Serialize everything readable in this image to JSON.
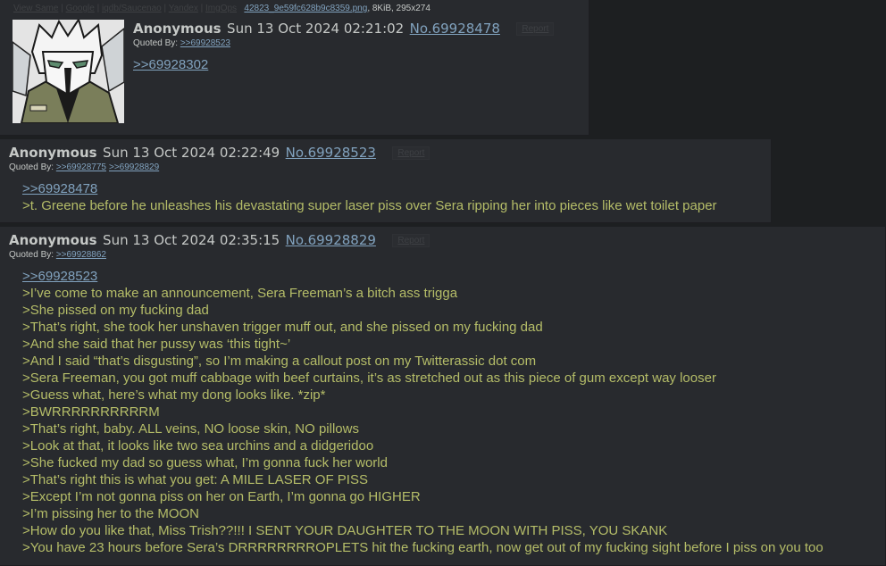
{
  "colors": {
    "background": "#1d1f21",
    "post": "#282a2e",
    "link": "#81a2be",
    "greentext": "#b5bd68",
    "text": "#c5c8c6"
  },
  "post1": {
    "file": {
      "links": [
        "View Same",
        "Google",
        "iqdb/Saucenao",
        "Yandex",
        "ImgOps"
      ],
      "filename": "42823_9e59fc628b9c8359.png",
      "meta": ", 8KiB, 295x274"
    },
    "name": "Anonymous",
    "date": "Sun 13 Oct 2024 02:21:02",
    "number": "No.69928478",
    "report": "Report",
    "quoted_by_label": "Quoted By:",
    "quoted_by": [
      ">>69928523"
    ],
    "lines": [
      {
        "type": "quotelink",
        "text": ">>69928302"
      }
    ]
  },
  "post2": {
    "name": "Anonymous",
    "date": "Sun 13 Oct 2024 02:22:49",
    "number": "No.69928523",
    "report": "Report",
    "quoted_by_label": "Quoted By:",
    "quoted_by": [
      ">>69928775",
      ">>69928829"
    ],
    "lines": [
      {
        "type": "quotelink",
        "text": ">>69928478"
      },
      {
        "type": "greentext",
        "text": ">t. Greene before he unleashes his devastating super laser piss over Sera ripping her into pieces like wet toilet paper"
      }
    ]
  },
  "post3": {
    "name": "Anonymous",
    "date": "Sun 13 Oct 2024 02:35:15",
    "number": "No.69928829",
    "report": "Report",
    "quoted_by_label": "Quoted By:",
    "quoted_by": [
      ">>69928862"
    ],
    "lines": [
      {
        "type": "quotelink",
        "text": ">>69928523"
      },
      {
        "type": "greentext",
        "text": ">I’ve come to make an announcement, Sera Freeman’s a bitch ass trigga"
      },
      {
        "type": "greentext",
        "text": ">She pissed on my fucking dad"
      },
      {
        "type": "greentext",
        "text": ">That’s right, she took her unshaven trigger muff out, and she pissed on my fucking dad"
      },
      {
        "type": "greentext",
        "text": ">And she said that her pussy was ‘this tight~’"
      },
      {
        "type": "greentext",
        "text": ">And I said “that’s disgusting”, so I’m making a callout post on my Twitterassic dot com"
      },
      {
        "type": "greentext",
        "text": ">Sera Freeman, you got muff cabbage with beef curtains, it’s as stretched out as this piece of gum except way looser"
      },
      {
        "type": "greentext",
        "text": ">Guess what, here’s what my dong looks like. *zip*"
      },
      {
        "type": "greentext",
        "text": ">BWRRRRRRRRRRM"
      },
      {
        "type": "greentext",
        "text": ">That’s right, baby. ALL veins, NO loose skin, NO pillows"
      },
      {
        "type": "greentext",
        "text": ">Look at that, it looks like two sea urchins and a didgeridoo"
      },
      {
        "type": "greentext",
        "text": ">She fucked my dad so guess what, I’m gonna fuck her world"
      },
      {
        "type": "greentext",
        "text": ">That’s right this is what you get: A MILE LASER OF PISS"
      },
      {
        "type": "greentext",
        "text": ">Except I’m not gonna piss on her on Earth, I’m gonna go HIGHER"
      },
      {
        "type": "greentext",
        "text": ">I’m pissing her to the MOON"
      },
      {
        "type": "greentext",
        "text": ">How do you like that, Miss Trish??!!! I SENT YOUR DAUGHTER TO THE MOON WITH PISS, YOU SKANK"
      },
      {
        "type": "greentext",
        "text": ">You have 23 hours before Sera’s DRRRRRRRROPLETS hit the fucking earth, now get out of my fucking sight before I piss on you too"
      }
    ]
  }
}
